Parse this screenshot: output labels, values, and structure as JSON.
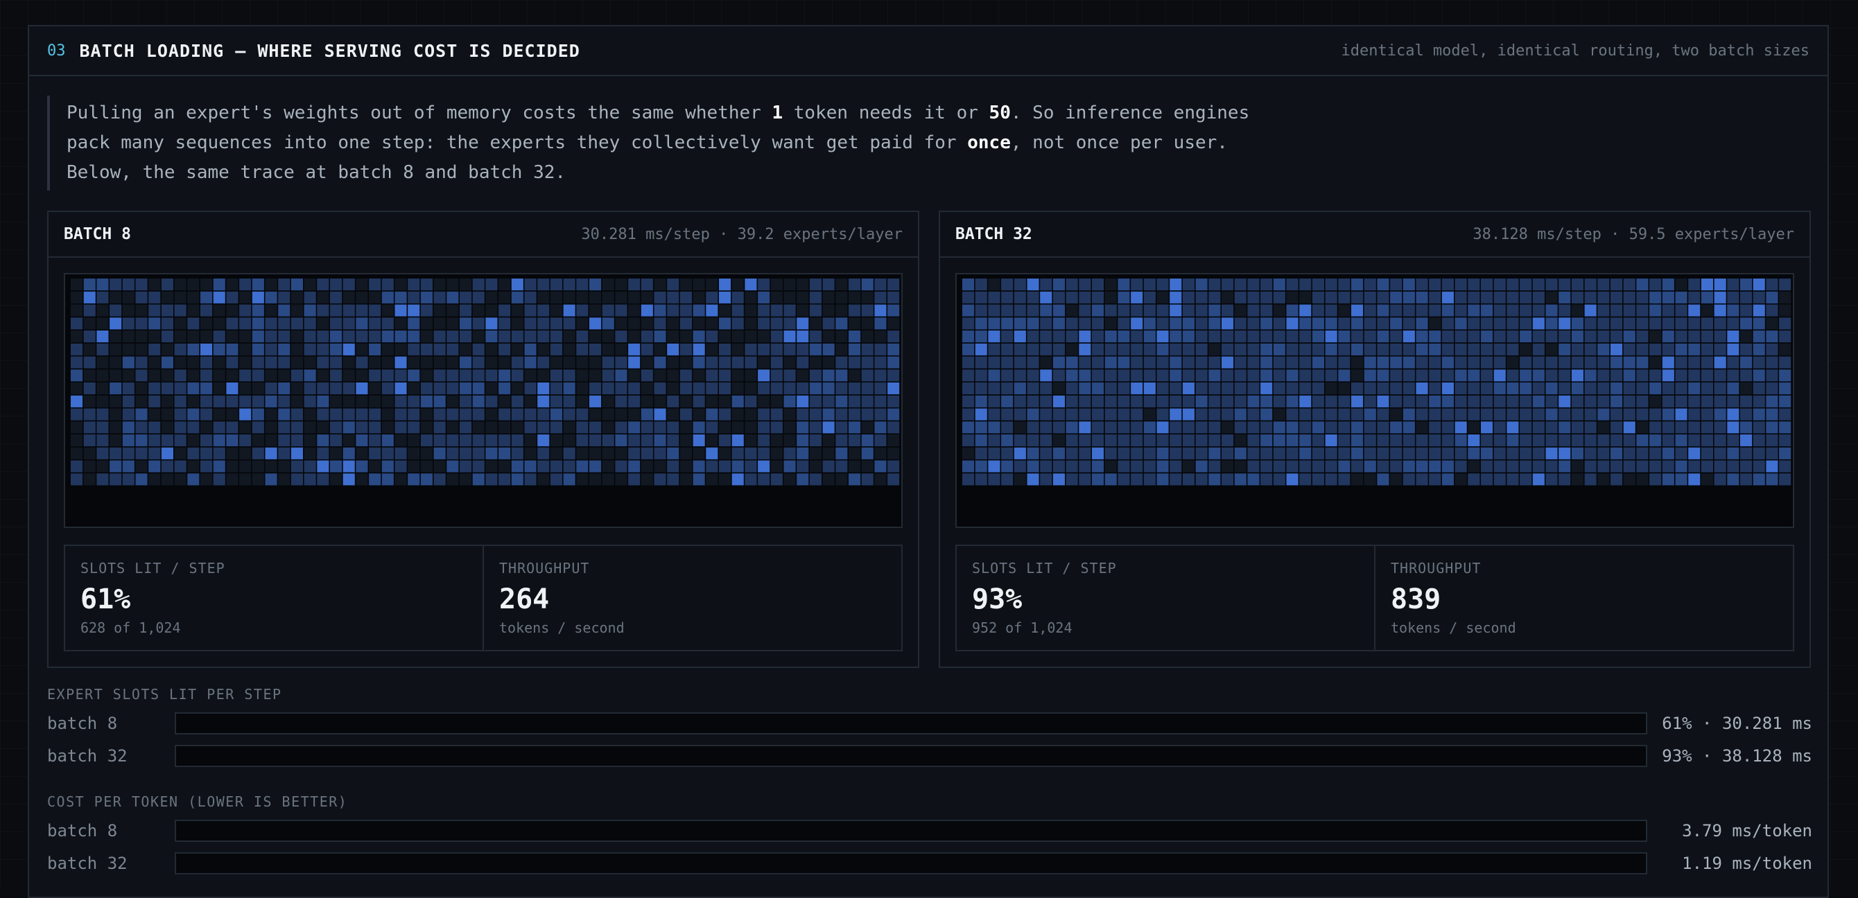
{
  "section": {
    "number": "03",
    "title": "BATCH LOADING — WHERE SERVING COST IS DECIDED",
    "subtitle": "identical model, identical routing, two batch sizes"
  },
  "intro": {
    "p1": "Pulling an expert's weights out of memory costs the same whether ",
    "b1": "1",
    "p2": " token needs it or ",
    "b2": "50",
    "p3": ". So inference engines pack many sequences into one step: the experts they collectively want get paid for ",
    "b3": "once",
    "p4": ", not once per user. Below, the same trace at batch 8 and batch 32."
  },
  "batches": [
    {
      "title": "BATCH 8",
      "meta": "30.281 ms/step · 39.2 experts/layer",
      "lit_fraction": 0.61,
      "stats": {
        "slots_label": "SLOTS LIT / STEP",
        "slots_value": "61%",
        "slots_sub": "628 of 1,024",
        "throughput_label": "THROUGHPUT",
        "throughput_value": "264",
        "throughput_sub": "tokens / second"
      }
    },
    {
      "title": "BATCH 32",
      "meta": "38.128 ms/step · 59.5 experts/layer",
      "lit_fraction": 0.93,
      "stats": {
        "slots_label": "SLOTS LIT / STEP",
        "slots_value": "93%",
        "slots_sub": "952 of 1,024",
        "throughput_label": "THROUGHPUT",
        "throughput_value": "839",
        "throughput_sub": "tokens / second"
      }
    }
  ],
  "slots_chart": {
    "title": "EXPERT SLOTS LIT PER STEP",
    "rows": [
      {
        "label": "batch 8",
        "value_text": "61% · 30.281 ms",
        "fraction": 0
      },
      {
        "label": "batch 32",
        "value_text": "93% · 38.128 ms",
        "fraction": 0
      }
    ]
  },
  "cost_chart": {
    "title": "COST PER TOKEN (LOWER IS BETTER)",
    "rows": [
      {
        "label": "batch 8",
        "value_text": "3.79 ms/token",
        "fraction": 0
      },
      {
        "label": "batch 32",
        "value_text": "1.19 ms/token",
        "fraction": 0
      }
    ]
  },
  "colors": {
    "accent": "#58c4e6",
    "cell_dim": "#111822",
    "cell_lit": "#22375f",
    "cell_mid": "#2a4a86",
    "cell_hot": "#3f6fd0"
  }
}
